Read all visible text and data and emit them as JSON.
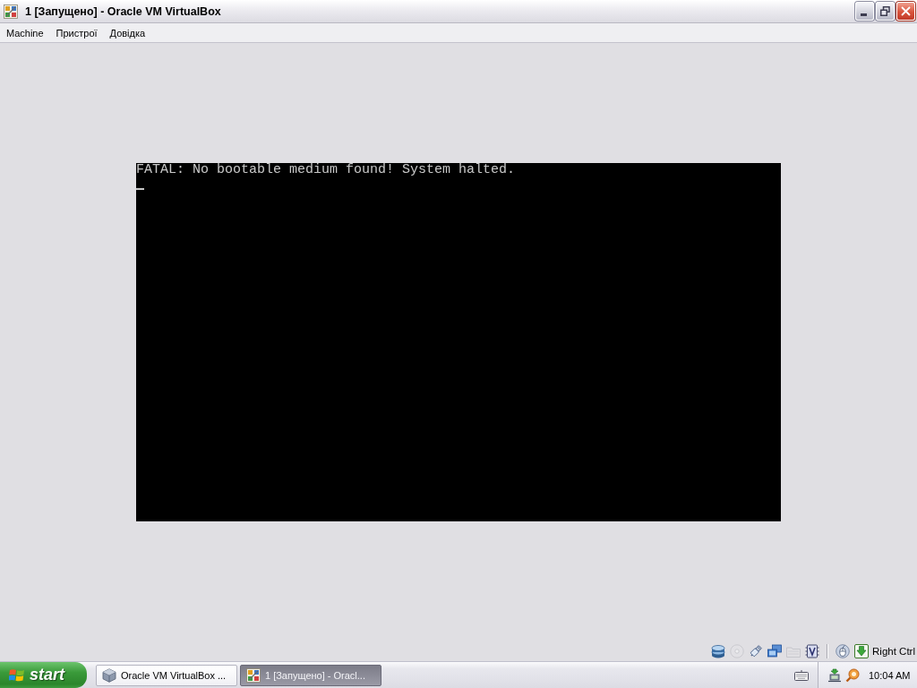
{
  "window": {
    "title": "1 [Запущено] - Oracle VM VirtualBox"
  },
  "menu": [
    {
      "label": "Machine"
    },
    {
      "label": "Пристрої"
    },
    {
      "label": "Довідка"
    }
  ],
  "console": {
    "lines": [
      "FATAL: No bootable medium found! System halted."
    ],
    "cursor": true
  },
  "status_bar": {
    "indicators": [
      {
        "kind": "hard_disk",
        "disabled": false
      },
      {
        "kind": "optical",
        "disabled": true
      },
      {
        "kind": "usb",
        "disabled": false
      },
      {
        "kind": "network",
        "disabled": false
      },
      {
        "kind": "shared_folders",
        "disabled": true
      },
      {
        "kind": "virtualization",
        "disabled": false
      },
      {
        "kind": "mouse",
        "disabled": false
      },
      {
        "kind": "keyboard",
        "disabled": false
      }
    ],
    "host_key": "Right Ctrl"
  },
  "taskbar": {
    "start_label": "start",
    "tasks": [
      {
        "kind": "manager",
        "label": "Oracle VM VirtualBox ...",
        "selected": false
      },
      {
        "kind": "machine",
        "label": "1 [Запущено] - Oracl...",
        "selected": true
      }
    ],
    "clock": "10:04 AM"
  }
}
